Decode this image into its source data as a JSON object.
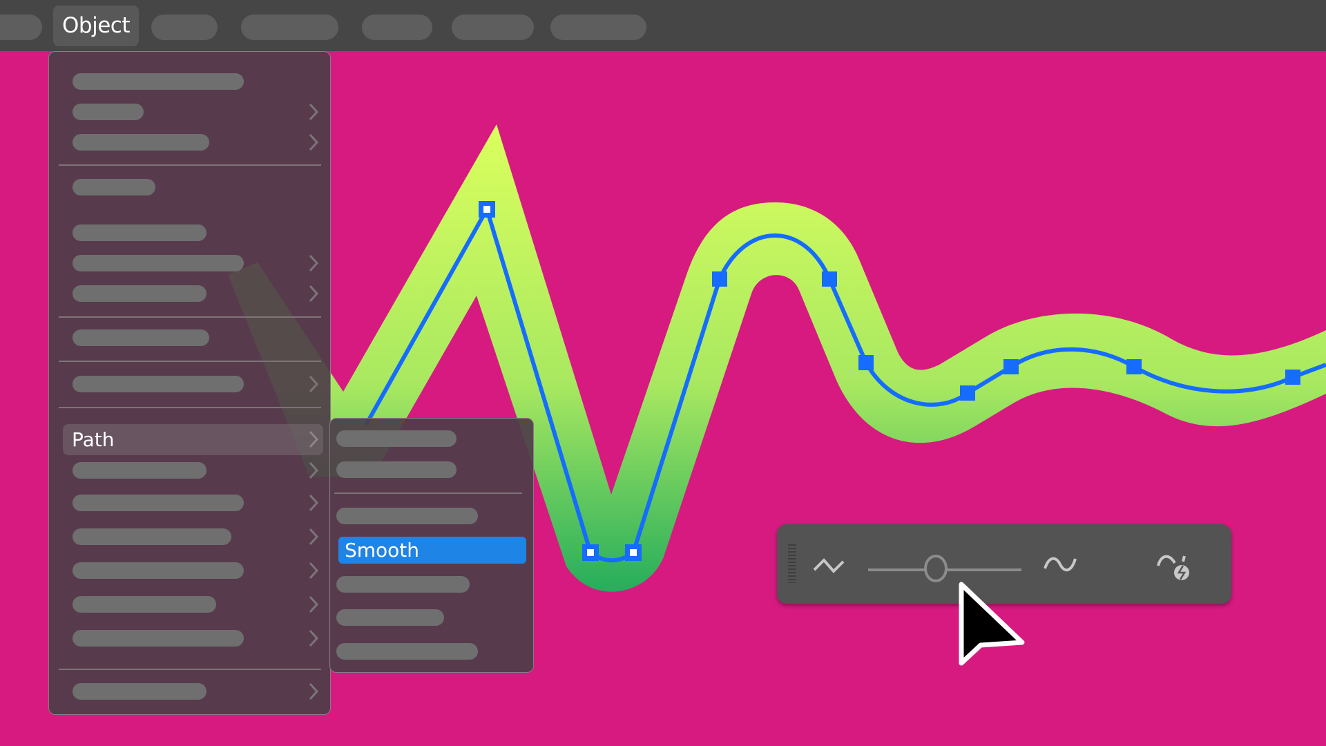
{
  "menubar": {
    "active_menu": "Object",
    "placeholder_menus": 6
  },
  "object_menu": {
    "items": [
      {
        "type": "item",
        "submenu": false
      },
      {
        "type": "item",
        "submenu": true
      },
      {
        "type": "item",
        "submenu": true
      },
      {
        "type": "separator"
      },
      {
        "type": "item",
        "submenu": false
      },
      {
        "type": "item",
        "submenu": false
      },
      {
        "type": "item",
        "submenu": true
      },
      {
        "type": "item",
        "submenu": true
      },
      {
        "type": "separator"
      },
      {
        "type": "item",
        "submenu": false
      },
      {
        "type": "separator"
      },
      {
        "type": "item",
        "submenu": true
      },
      {
        "type": "separator"
      },
      {
        "type": "item",
        "label": "Path",
        "submenu": true,
        "highlighted": true
      },
      {
        "type": "item",
        "submenu": true
      },
      {
        "type": "item",
        "submenu": true
      },
      {
        "type": "item",
        "submenu": true
      },
      {
        "type": "item",
        "submenu": true
      },
      {
        "type": "item",
        "submenu": true
      },
      {
        "type": "item",
        "submenu": true
      },
      {
        "type": "separator"
      },
      {
        "type": "item",
        "submenu": true
      }
    ],
    "path_label": "Path"
  },
  "path_submenu": {
    "selected_label": "Smooth",
    "selected_color": "#1e84e6",
    "placeholder_items": 6
  },
  "smooth_toolbar": {
    "left_icon": "jagged-path-icon",
    "right_icon": "smooth-path-icon",
    "auto_icon": "auto-smooth-icon",
    "slider_value": 0.44
  },
  "artwork": {
    "background": "#d61a80",
    "stroke_gradient_top": "#dbff5e",
    "stroke_gradient_bottom": "#22ab5c",
    "path_color": "#156cff"
  }
}
